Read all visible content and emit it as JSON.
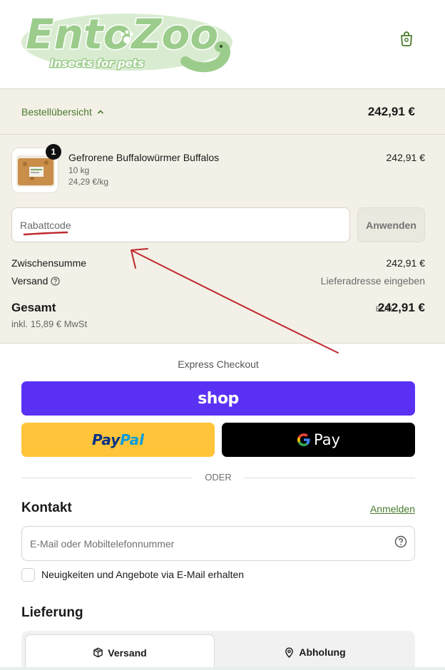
{
  "brand": {
    "logo_text": "EntoZoo",
    "tagline": "Insects for pets",
    "logo_color": "#9ccc8c"
  },
  "summary": {
    "toggle_label": "Bestellübersicht",
    "header_total": "242,91 €"
  },
  "product": {
    "quantity": "1",
    "name": "Gefrorene Buffalowürmer Buffalos",
    "variant": "10 kg",
    "unit_price": "24,29 €/kg",
    "price": "242,91 €"
  },
  "discount": {
    "placeholder": "Rabattcode",
    "apply_label": "Anwenden"
  },
  "totals": {
    "subtotal_label": "Zwischensumme",
    "subtotal_value": "242,91 €",
    "shipping_label": "Versand",
    "shipping_value": "Lieferadresse eingeben",
    "total_label": "Gesamt",
    "tax_note": "inkl. 15,89 € MwSt",
    "currency": "EUR",
    "total_value": "242,91 €"
  },
  "express": {
    "title": "Express Checkout",
    "shop_label": "shop",
    "paypal_pay": "Pay",
    "paypal_pal": "Pal",
    "gpay_label": "Pay",
    "divider_label": "ODER"
  },
  "contact": {
    "title": "Kontakt",
    "login_label": "Anmelden",
    "email_placeholder": "E-Mail oder Mobiltelefonnummer",
    "newsletter_label": "Neuigkeiten und Angebote via E-Mail erhalten",
    "newsletter_checked": false
  },
  "delivery": {
    "title": "Lieferung",
    "tabs": [
      {
        "label": "Versand",
        "icon": "box-icon",
        "selected": true
      },
      {
        "label": "Abholung",
        "icon": "location-pin-icon",
        "selected": false
      }
    ]
  },
  "colors": {
    "accent_green": "#4a7a2c",
    "summary_bg": "#f3f0e7",
    "shop_purple": "#5a31f4",
    "paypal_yellow": "#ffc439",
    "annotation_red": "#c0282d"
  }
}
